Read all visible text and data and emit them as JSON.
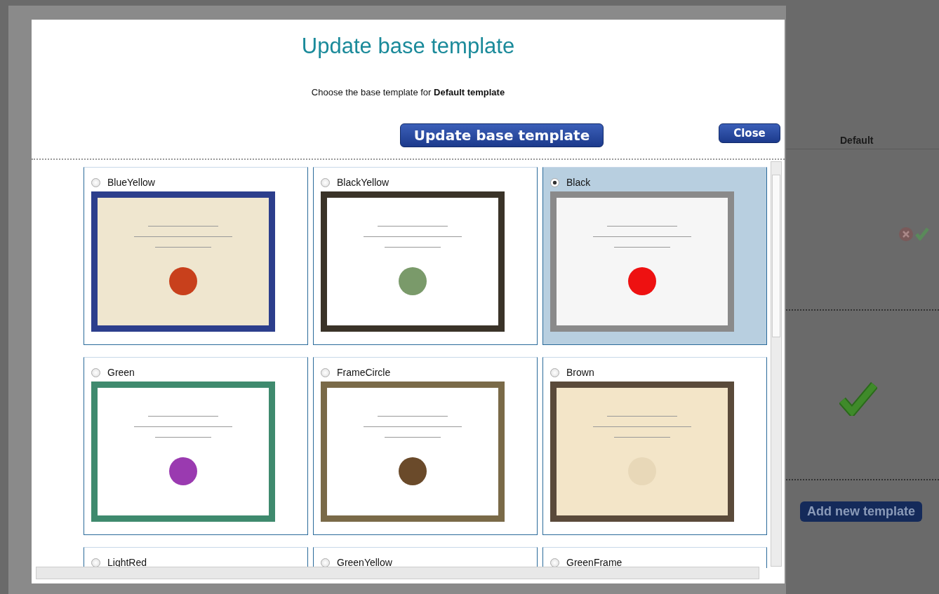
{
  "background_page": {
    "column_header": "Default",
    "add_button": "Add new template"
  },
  "dialog": {
    "title": "Update base template",
    "instruction": "Choose the base template for **Default template**",
    "update_button": "Update base template",
    "close_button": "Close"
  },
  "templates": [
    {
      "name": "BlueYellow",
      "selected": false,
      "preview": true
    },
    {
      "name": "BlackYellow",
      "selected": false,
      "preview": true
    },
    {
      "name": "Black",
      "selected": true,
      "preview": true
    },
    {
      "name": "Green",
      "selected": false,
      "preview": true
    },
    {
      "name": "FrameCircle",
      "selected": false,
      "preview": true
    },
    {
      "name": "Brown",
      "selected": false,
      "preview": true
    },
    {
      "name": "LightRed",
      "selected": false
    },
    {
      "name": "GreenYellow",
      "selected": false
    },
    {
      "name": "GreenFrame",
      "selected": false
    }
  ]
}
